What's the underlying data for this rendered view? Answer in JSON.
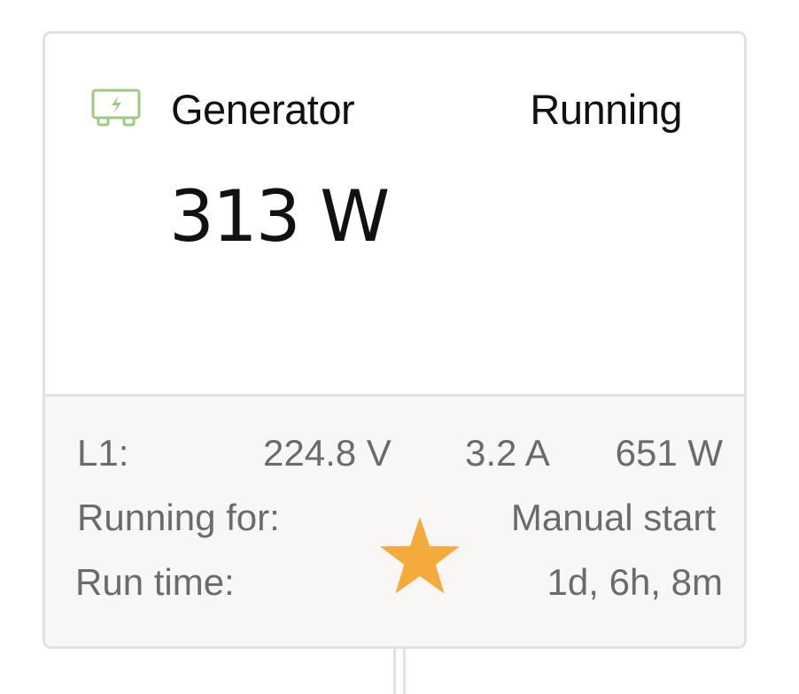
{
  "card": {
    "icon": "generator-icon",
    "title": "Generator",
    "status": "Running",
    "power": "313 W"
  },
  "details": {
    "l1": {
      "label": "L1:",
      "voltage": "224.8 V",
      "current": "3.2 A",
      "power": "651 W"
    },
    "running_for": {
      "label": "Running for:",
      "value": "Manual start"
    },
    "run_time": {
      "label": "Run time:",
      "value": "1d, 6h, 8m"
    },
    "star_icon": "star-icon"
  },
  "colors": {
    "icon_green": "#9ccb7f",
    "star_orange": "#f5aa3c",
    "label_gray": "#6b6b6b",
    "border": "#e2e2e2",
    "footer_bg": "#f8f7f5"
  }
}
